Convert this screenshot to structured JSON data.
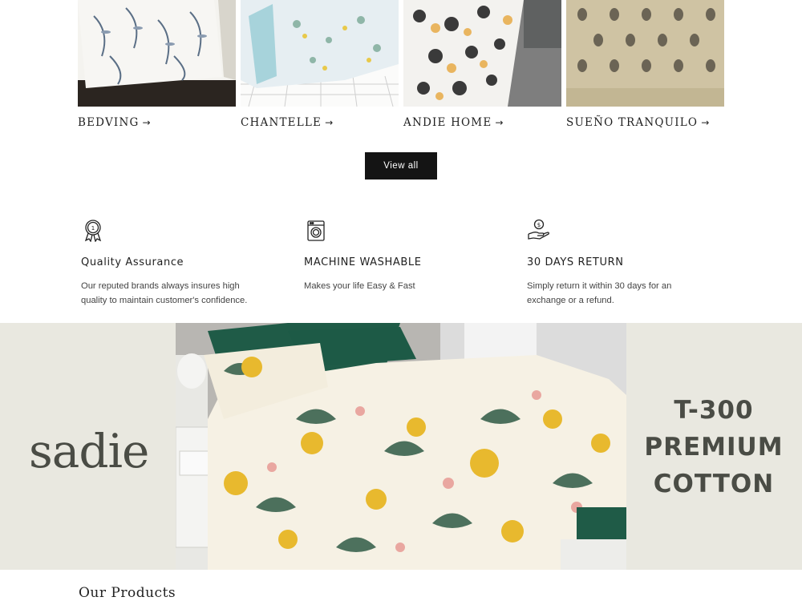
{
  "collections": [
    {
      "name": "BEDVING",
      "arrow": "→"
    },
    {
      "name": "CHANTELLE",
      "arrow": "→"
    },
    {
      "name": "ANDIE HOME",
      "arrow": "→"
    },
    {
      "name": "SUEÑO TRANQUILO",
      "arrow": "→"
    }
  ],
  "view_all_label": "View all",
  "features": [
    {
      "icon": "award-medal-icon",
      "title": "Quality Assurance",
      "text_line1": "Our reputed brands always insures high",
      "text_line2": "quality to maintain customer's confidence."
    },
    {
      "icon": "washing-machine-icon",
      "title": "MACHINE WASHABLE",
      "text_line1": "Makes your life Easy & Fast",
      "text_line2": ""
    },
    {
      "icon": "money-hand-icon",
      "title": "30 DAYS RETURN",
      "text_line1": "Simply return it within 30 days for an",
      "text_line2": "exchange or a refund."
    }
  ],
  "banner": {
    "brand": "sadie",
    "tagline_line1": "T-300",
    "tagline_line2": "PREMIUM",
    "tagline_line3": "COTTON"
  },
  "section_title": "Our Products",
  "colors": {
    "button_bg": "#141414",
    "banner_bg": "#e9e8e0",
    "banner_text": "#4a4c45",
    "bed_green": "#1f5b47"
  }
}
